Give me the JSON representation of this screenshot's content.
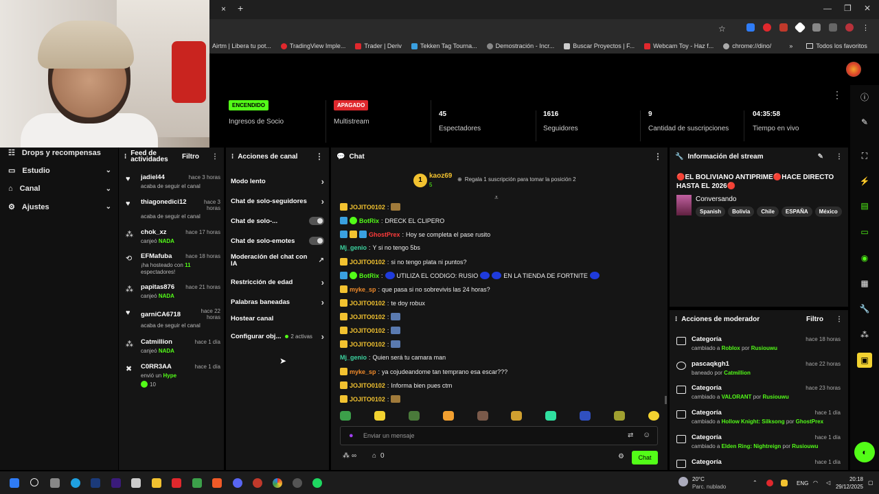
{
  "browser": {
    "bookmarks": [
      "Airtm | Libera tu pot...",
      "TradingView Imple...",
      "Trader | Deriv",
      "Tekken Tag Tourna...",
      "Demostración - Incr...",
      "Buscar Proyectos | F...",
      "Webcam Toy - Haz f...",
      "chrome://dino/"
    ],
    "bookmarks_more": "»",
    "all_favorites": "Todos los favoritos",
    "tab_close": "×",
    "tab_new": "+"
  },
  "stats": [
    {
      "badge": "ENCENDIDO",
      "badge_color": "#53fc18",
      "label": "Ingresos de Socio"
    },
    {
      "badge": "APAGADO",
      "badge_color": "#e0282d",
      "label": "Multistream"
    },
    {
      "value": "45",
      "label": "Espectadores"
    },
    {
      "value": "1616",
      "label": "Seguidores"
    },
    {
      "value": "9",
      "label": "Cantidad de suscripciones"
    },
    {
      "value": "04:35:58",
      "label": "Tiempo en vivo"
    }
  ],
  "nav": [
    {
      "label": "Drops y recompensas",
      "icon": "gift-icon"
    },
    {
      "label": "Estudio",
      "icon": "tv-icon"
    },
    {
      "label": "Canal",
      "icon": "channel-icon"
    },
    {
      "label": "Ajustes",
      "icon": "gear-icon"
    }
  ],
  "activity": {
    "title": "Feed de actividades",
    "filter": "Filtro",
    "items": [
      {
        "user": "jadiel44",
        "time": "hace 3 horas",
        "desc": "acaba de seguir el canal"
      },
      {
        "user": "thiagonedici12",
        "time": "hace 3 horas",
        "desc": "acaba de seguir el canal"
      },
      {
        "user": "chok_xz",
        "time": "hace 17 horas",
        "desc_pre": "canjeó",
        "desc_hl": "NADA"
      },
      {
        "user": "EFMafuba",
        "time": "hace 18 horas",
        "desc_pre": "¡ha hosteado con",
        "desc_hl": "11",
        "desc_post": "espectadores!"
      },
      {
        "user": "papitas876",
        "time": "hace 21 horas",
        "desc_pre": "canjeó",
        "desc_hl": "NADA"
      },
      {
        "user": "garniCA6718",
        "time": "hace 22 horas",
        "desc": "acaba de seguir el canal"
      },
      {
        "user": "Catmillion",
        "time": "hace 1 día",
        "desc_pre": "canjeó",
        "desc_hl": "NADA"
      },
      {
        "user": "C0RR3AA",
        "time": "hace 1 día",
        "desc_pre": "envió un",
        "desc_hl": "Hype",
        "amount": "10"
      }
    ]
  },
  "actions": {
    "title": "Acciones de canal",
    "items": [
      {
        "label": "Modo lento",
        "kind": "chev"
      },
      {
        "label": "Chat de solo-seguidores",
        "kind": "chev"
      },
      {
        "label": "Chat de solo-...",
        "kind": "toggle"
      },
      {
        "label": "Chat de solo-emotes",
        "kind": "toggle"
      },
      {
        "label": "Moderación del chat con IA",
        "kind": "ext"
      },
      {
        "label": "Restricción de edad",
        "kind": "chev"
      },
      {
        "label": "Palabras baneadas",
        "kind": "chev"
      },
      {
        "label": "Hostear canal",
        "kind": "none"
      },
      {
        "label": "Configurar obj...",
        "kind": "chev",
        "extra": "2 activas"
      }
    ]
  },
  "chat": {
    "title": "Chat",
    "pinned_user": "kaoz69",
    "pinned_rank": "1",
    "pinned_count": "5",
    "pinned_cta": "Regala 1 suscripción para tomar la posición 2",
    "messages": [
      {
        "user": "JOJITO0102",
        "color": "yellow",
        "text": ""
      },
      {
        "user": "BotRix",
        "color": "green",
        "text": "DRECK EL CLIPERO"
      },
      {
        "user": "GhostPrex",
        "color": "red",
        "text": "Hoy se completa el pase rusito"
      },
      {
        "user": "Mj_genio",
        "color": "teal",
        "text": "Y si no tengo 5bs"
      },
      {
        "user": "JOJITO0102",
        "color": "yellow",
        "text": "si no tengo plata ni puntos?"
      },
      {
        "user": "BotRix",
        "color": "green",
        "text": "UTILIZA EL CODIGO: RUSIO",
        "text2": "EN LA TIENDA DE FORTNITE"
      },
      {
        "user": "myke_sp",
        "color": "orange",
        "text": "que pasa si no sobrevivis las 24 horas?"
      },
      {
        "user": "JOJITO0102",
        "color": "yellow",
        "text": "te doy robux"
      },
      {
        "user": "JOJITO0102",
        "color": "yellow",
        "text": ""
      },
      {
        "user": "JOJITO0102",
        "color": "yellow",
        "text": ""
      },
      {
        "user": "JOJITO0102",
        "color": "yellow",
        "text": ""
      },
      {
        "user": "Mj_genio",
        "color": "teal",
        "text": "Quien será tu camara man"
      },
      {
        "user": "myke_sp",
        "color": "orange",
        "text": "ya cojudeandome tan temprano esa escar???"
      },
      {
        "user": "JOJITO0102",
        "color": "yellow",
        "text": "Informa bien pues ctm"
      },
      {
        "user": "JOJITO0102",
        "color": "yellow",
        "text": ""
      }
    ],
    "placeholder": "Enviar un mensaje",
    "viewers_icon_text": "∞",
    "store_count": "0",
    "send_label": "Chat"
  },
  "streaminfo": {
    "title": "Información del stream",
    "stream_title": "🔴EL BOLIVIANO ANTIPRIME🔴HACE DIRECTO HASTA EL 2026🔴",
    "category": "Conversando",
    "tags": [
      "Spanish",
      "Bolivia",
      "Chile",
      "ESPAÑA",
      "México"
    ]
  },
  "mod": {
    "title": "Acciones de moderador",
    "filter": "Filtro",
    "items": [
      {
        "title": "Categoría",
        "time": "hace 18 horas",
        "pre": "cambiado a",
        "hl": "Roblox",
        "mid": "por",
        "by": "Rusiouwu"
      },
      {
        "title": "pascaqkgh1",
        "time": "hace 22 horas",
        "pre": "baneado por",
        "hl": "",
        "mid": "",
        "by": "Catmillion"
      },
      {
        "title": "Categoría",
        "time": "hace 23 horas",
        "pre": "cambiado a",
        "hl": "VALORANT",
        "mid": "por",
        "by": "Rusiouwu"
      },
      {
        "title": "Categoría",
        "time": "hace 1 día",
        "pre": "cambiado a",
        "hl": "Hollow Knight: Silksong",
        "mid": "por",
        "by": "GhostPrex"
      },
      {
        "title": "Categoría",
        "time": "hace 1 día",
        "pre": "cambiado a",
        "hl": "Elden Ring: Nightreign",
        "mid": "por",
        "by": "Rusiouwu"
      },
      {
        "title": "Categoría",
        "time": "hace 1 día",
        "pre": "",
        "hl": "",
        "mid": "",
        "by": ""
      }
    ]
  },
  "taskbar": {
    "weather_temp": "20°C",
    "weather_desc": "Parc. nublado",
    "lang": "ENG",
    "time": "20:18",
    "date": "29/12/2025"
  },
  "colors": {
    "accent": "#53fc18",
    "panel": "#151515",
    "background": "#000000"
  }
}
